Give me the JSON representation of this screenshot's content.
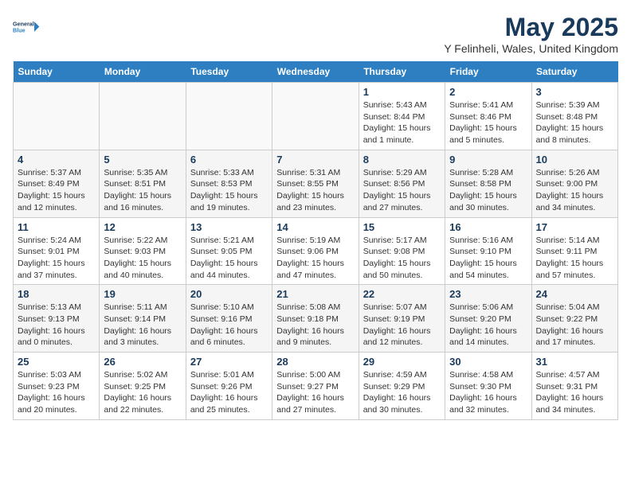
{
  "header": {
    "logo_line1": "General",
    "logo_line2": "Blue",
    "month": "May 2025",
    "location": "Y Felinheli, Wales, United Kingdom"
  },
  "weekdays": [
    "Sunday",
    "Monday",
    "Tuesday",
    "Wednesday",
    "Thursday",
    "Friday",
    "Saturday"
  ],
  "weeks": [
    [
      {
        "day": "",
        "info": ""
      },
      {
        "day": "",
        "info": ""
      },
      {
        "day": "",
        "info": ""
      },
      {
        "day": "",
        "info": ""
      },
      {
        "day": "1",
        "info": "Sunrise: 5:43 AM\nSunset: 8:44 PM\nDaylight: 15 hours\nand 1 minute."
      },
      {
        "day": "2",
        "info": "Sunrise: 5:41 AM\nSunset: 8:46 PM\nDaylight: 15 hours\nand 5 minutes."
      },
      {
        "day": "3",
        "info": "Sunrise: 5:39 AM\nSunset: 8:48 PM\nDaylight: 15 hours\nand 8 minutes."
      }
    ],
    [
      {
        "day": "4",
        "info": "Sunrise: 5:37 AM\nSunset: 8:49 PM\nDaylight: 15 hours\nand 12 minutes."
      },
      {
        "day": "5",
        "info": "Sunrise: 5:35 AM\nSunset: 8:51 PM\nDaylight: 15 hours\nand 16 minutes."
      },
      {
        "day": "6",
        "info": "Sunrise: 5:33 AM\nSunset: 8:53 PM\nDaylight: 15 hours\nand 19 minutes."
      },
      {
        "day": "7",
        "info": "Sunrise: 5:31 AM\nSunset: 8:55 PM\nDaylight: 15 hours\nand 23 minutes."
      },
      {
        "day": "8",
        "info": "Sunrise: 5:29 AM\nSunset: 8:56 PM\nDaylight: 15 hours\nand 27 minutes."
      },
      {
        "day": "9",
        "info": "Sunrise: 5:28 AM\nSunset: 8:58 PM\nDaylight: 15 hours\nand 30 minutes."
      },
      {
        "day": "10",
        "info": "Sunrise: 5:26 AM\nSunset: 9:00 PM\nDaylight: 15 hours\nand 34 minutes."
      }
    ],
    [
      {
        "day": "11",
        "info": "Sunrise: 5:24 AM\nSunset: 9:01 PM\nDaylight: 15 hours\nand 37 minutes."
      },
      {
        "day": "12",
        "info": "Sunrise: 5:22 AM\nSunset: 9:03 PM\nDaylight: 15 hours\nand 40 minutes."
      },
      {
        "day": "13",
        "info": "Sunrise: 5:21 AM\nSunset: 9:05 PM\nDaylight: 15 hours\nand 44 minutes."
      },
      {
        "day": "14",
        "info": "Sunrise: 5:19 AM\nSunset: 9:06 PM\nDaylight: 15 hours\nand 47 minutes."
      },
      {
        "day": "15",
        "info": "Sunrise: 5:17 AM\nSunset: 9:08 PM\nDaylight: 15 hours\nand 50 minutes."
      },
      {
        "day": "16",
        "info": "Sunrise: 5:16 AM\nSunset: 9:10 PM\nDaylight: 15 hours\nand 54 minutes."
      },
      {
        "day": "17",
        "info": "Sunrise: 5:14 AM\nSunset: 9:11 PM\nDaylight: 15 hours\nand 57 minutes."
      }
    ],
    [
      {
        "day": "18",
        "info": "Sunrise: 5:13 AM\nSunset: 9:13 PM\nDaylight: 16 hours\nand 0 minutes."
      },
      {
        "day": "19",
        "info": "Sunrise: 5:11 AM\nSunset: 9:14 PM\nDaylight: 16 hours\nand 3 minutes."
      },
      {
        "day": "20",
        "info": "Sunrise: 5:10 AM\nSunset: 9:16 PM\nDaylight: 16 hours\nand 6 minutes."
      },
      {
        "day": "21",
        "info": "Sunrise: 5:08 AM\nSunset: 9:18 PM\nDaylight: 16 hours\nand 9 minutes."
      },
      {
        "day": "22",
        "info": "Sunrise: 5:07 AM\nSunset: 9:19 PM\nDaylight: 16 hours\nand 12 minutes."
      },
      {
        "day": "23",
        "info": "Sunrise: 5:06 AM\nSunset: 9:20 PM\nDaylight: 16 hours\nand 14 minutes."
      },
      {
        "day": "24",
        "info": "Sunrise: 5:04 AM\nSunset: 9:22 PM\nDaylight: 16 hours\nand 17 minutes."
      }
    ],
    [
      {
        "day": "25",
        "info": "Sunrise: 5:03 AM\nSunset: 9:23 PM\nDaylight: 16 hours\nand 20 minutes."
      },
      {
        "day": "26",
        "info": "Sunrise: 5:02 AM\nSunset: 9:25 PM\nDaylight: 16 hours\nand 22 minutes."
      },
      {
        "day": "27",
        "info": "Sunrise: 5:01 AM\nSunset: 9:26 PM\nDaylight: 16 hours\nand 25 minutes."
      },
      {
        "day": "28",
        "info": "Sunrise: 5:00 AM\nSunset: 9:27 PM\nDaylight: 16 hours\nand 27 minutes."
      },
      {
        "day": "29",
        "info": "Sunrise: 4:59 AM\nSunset: 9:29 PM\nDaylight: 16 hours\nand 30 minutes."
      },
      {
        "day": "30",
        "info": "Sunrise: 4:58 AM\nSunset: 9:30 PM\nDaylight: 16 hours\nand 32 minutes."
      },
      {
        "day": "31",
        "info": "Sunrise: 4:57 AM\nSunset: 9:31 PM\nDaylight: 16 hours\nand 34 minutes."
      }
    ]
  ]
}
